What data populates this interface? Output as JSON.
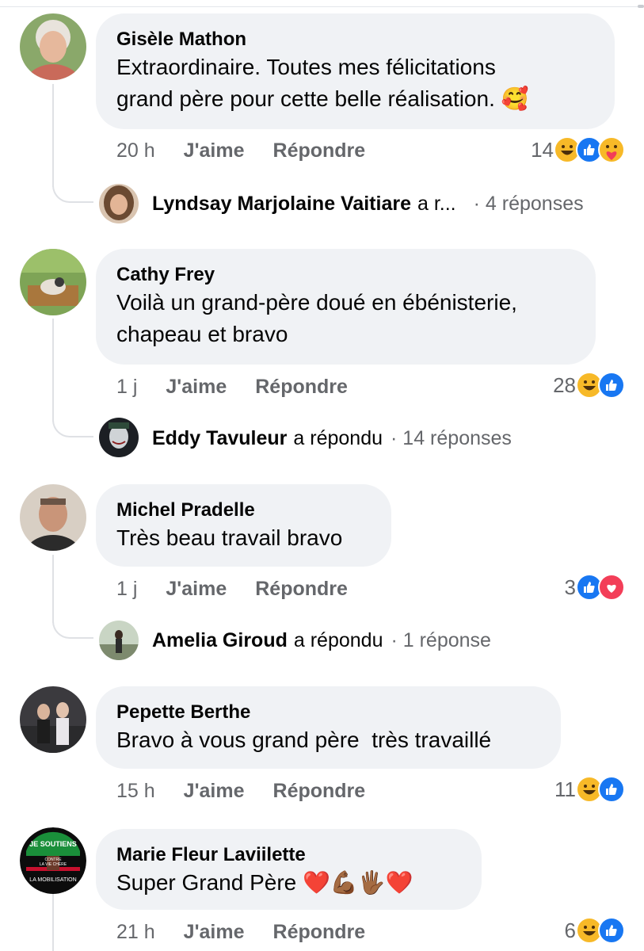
{
  "comments": [
    {
      "author": "Gisèle Mathon",
      "text_lines": [
        "Extraordinaire. Toutes mes félicitations",
        "grand père pour cette belle réalisation. 🥰"
      ],
      "time": "20 h",
      "like_label": "J'aime",
      "reply_label": "Répondre",
      "reaction_count": "14",
      "reactions": [
        "haha-icon",
        "like-icon",
        "care-icon"
      ],
      "reply": {
        "author": "Lyndsay Marjolaine Vaitiare",
        "verb": "a r...",
        "count": "· 4 réponses"
      }
    },
    {
      "author": "Cathy Frey",
      "text_lines": [
        "Voilà un grand-père doué en ébénisterie,",
        "chapeau et bravo"
      ],
      "time": "1 j",
      "like_label": "J'aime",
      "reply_label": "Répondre",
      "reaction_count": "28",
      "reactions": [
        "haha-icon",
        "like-icon"
      ],
      "reply": {
        "author": "Eddy Tavuleur",
        "verb": "a répondu",
        "count": "· 14 réponses"
      }
    },
    {
      "author": "Michel Pradelle",
      "text_lines": [
        "Très beau travail bravo"
      ],
      "time": "1 j",
      "like_label": "J'aime",
      "reply_label": "Répondre",
      "reaction_count": "3",
      "reactions": [
        "like-icon",
        "love-icon"
      ],
      "reply": {
        "author": "Amelia Giroud",
        "verb": "a répondu",
        "count": "· 1 réponse"
      }
    },
    {
      "author": "Pepette Berthe",
      "text_lines": [
        "Bravo à vous grand père  très travaillé"
      ],
      "time": "15 h",
      "like_label": "J'aime",
      "reply_label": "Répondre",
      "reaction_count": "11",
      "reactions": [
        "haha-icon",
        "like-icon"
      ]
    },
    {
      "author": "Marie Fleur Laviilette",
      "text_lines": [
        "Super Grand Père ❤️💪🏾🖐🏾❤️"
      ],
      "time": "21 h",
      "like_label": "J'aime",
      "reply_label": "Répondre",
      "reaction_count": "6",
      "reactions": [
        "haha-icon",
        "like-icon"
      ]
    }
  ],
  "avatar_badge": {
    "lines": [
      "JE SOUTIENS",
      "CONTRE",
      "LA VIE CHÈRE",
      "LA MOBILISATION"
    ]
  },
  "colors": {
    "bubble": "#f0f2f5",
    "meta": "#65676b",
    "like_blue": "#1877f2",
    "haha_yellow": "#f7b928",
    "love_red": "#f33e58"
  }
}
